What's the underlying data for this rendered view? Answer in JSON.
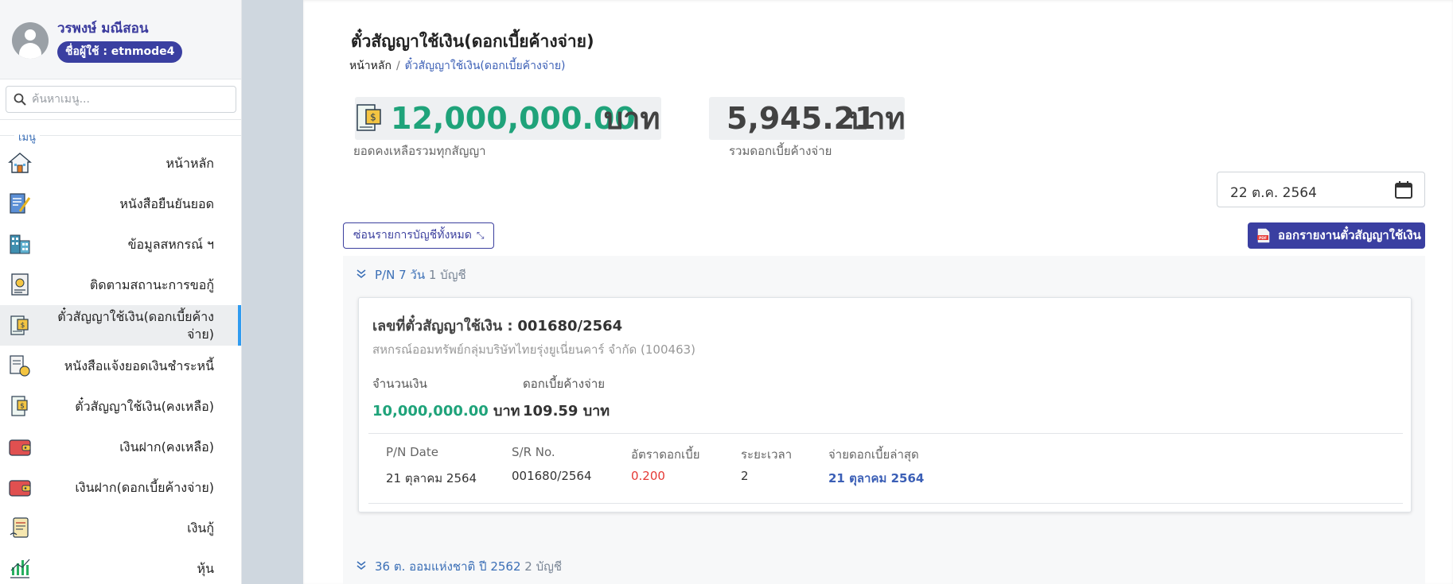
{
  "profile": {
    "name": "วรพงษ์ มณีสอน",
    "user_badge": "ชื่อผู้ใช้ : etnmode4"
  },
  "search": {
    "placeholder": "ค้นหาเมนู..."
  },
  "menu": {
    "header": "เมนู",
    "items": [
      {
        "label": "หน้าหลัก",
        "icon": "home-icon"
      },
      {
        "label": "หนังสือยืนยันยอด",
        "icon": "document-sign-icon"
      },
      {
        "label": "ข้อมูลสหกรณ์ ฯ",
        "icon": "building-icon"
      },
      {
        "label": "ติดตามสถานะการขอกู้",
        "icon": "loan-status-icon"
      },
      {
        "label": "ตั๋วสัญญาใช้เงิน(ดอกเบี้ยค้างจ่าย)",
        "icon": "promissory-note-icon",
        "active": true
      },
      {
        "label": "หนังสือแจ้งยอดเงินชำระหนี้",
        "icon": "debt-notice-icon"
      },
      {
        "label": "ตั๋วสัญญาใช้เงิน(คงเหลือ)",
        "icon": "promissory-balance-icon"
      },
      {
        "label": "เงินฝาก(คงเหลือ)",
        "icon": "wallet-icon"
      },
      {
        "label": "เงินฝาก(ดอกเบี้ยค้างจ่าย)",
        "icon": "wallet-interest-icon"
      },
      {
        "label": "เงินกู้",
        "icon": "loan-icon"
      },
      {
        "label": "หุ้น",
        "icon": "stock-chart-icon"
      }
    ]
  },
  "page": {
    "title": "ตั๋วสัญญาใช้เงิน(ดอกเบี้ยค้างจ่าย)",
    "breadcrumb": {
      "home": "หน้าหลัก",
      "separator": "/",
      "current": "ตั๋วสัญญาใช้เงิน(ดอกเบี้ยค้างจ่าย)"
    }
  },
  "summary": {
    "total_balance": "12,000,000.00",
    "total_balance_unit": "บาท",
    "total_balance_label": "ยอดคงเหลือรวมทุกสัญญา",
    "total_interest": "5,945.21",
    "total_interest_unit": "บาท",
    "total_interest_label": "รวมดอกเบี้ยค้างจ่าย"
  },
  "date_picker": {
    "value": "22 ต.ค. 2564"
  },
  "actions": {
    "collapse_all": "ซ่อนรายการบัญชีทั้งหมด",
    "export_report": "ออกรายงานตั๋วสัญญาใช้เงิน"
  },
  "groups": [
    {
      "name": "P/N 7 วัน",
      "count": "1 บัญชี"
    },
    {
      "name": "36 ต. ออมแห่งชาติ ปี 2562",
      "count": "2 บัญชี"
    }
  ],
  "card": {
    "title_label": "เลขที่ตั๋วสัญญาใช้เงิน :",
    "title_value": "001680/2564",
    "subtitle": "สหกรณ์ออมทรัพย์กลุ่มบริษัทไทยรุ่งยูเนี่ยนคาร์ จำกัด (100463)",
    "amount_label": "จำนวนเงิน",
    "amount_value": "10,000,000.00",
    "amount_unit": "บาท",
    "interest_label": "ดอกเบี้ยค้างจ่าย",
    "interest_value": "109.59 บาท",
    "columns": {
      "pn_date": "P/N Date",
      "sr_no": "S/R No.",
      "rate": "อัตราดอกเบี้ย",
      "period": "ระยะเวลา",
      "last_paid": "จ่ายดอกเบี้ยล่าสุด"
    },
    "values": {
      "pn_date": "21 ตุลาคม 2564",
      "sr_no": "001680/2564",
      "rate": "0.200",
      "period": "2",
      "last_paid": "21 ตุลาคม 2564"
    }
  },
  "colors": {
    "accent": "#3a3fa1",
    "green": "#1fa37a",
    "rate_red": "#e53935",
    "link_blue": "#3b5fb6",
    "active_bar": "#2f9bf0"
  }
}
